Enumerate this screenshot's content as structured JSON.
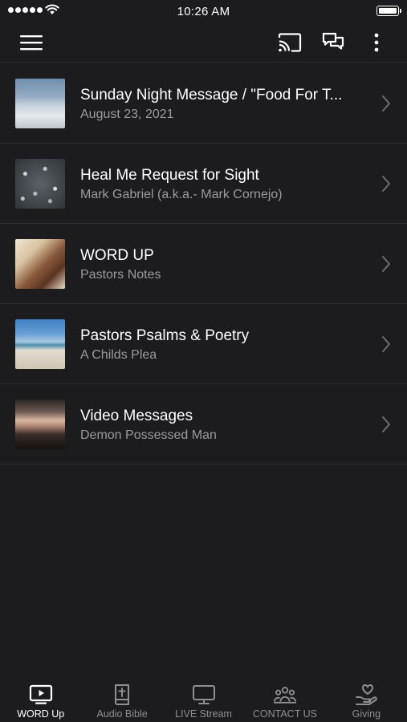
{
  "status_bar": {
    "time": "10:26 AM"
  },
  "top_bar": {
    "icons": [
      "menu-icon",
      "cast-icon",
      "chat-icon",
      "more-vertical-icon"
    ]
  },
  "list": {
    "items": [
      {
        "title": "Sunday Night Message / \"Food For T...",
        "subtitle": "August 23, 2021",
        "thumb": "clouds"
      },
      {
        "title": "Heal Me Request for Sight",
        "subtitle": "Mark Gabriel (a.k.a.- Mark Cornejo)",
        "thumb": "stars"
      },
      {
        "title": "WORD UP",
        "subtitle": "Pastors Notes",
        "thumb": "hands"
      },
      {
        "title": "Pastors Psalms & Poetry",
        "subtitle": "A Childs Plea",
        "thumb": "beach"
      },
      {
        "title": "Video Messages",
        "subtitle": "Demon Possessed Man",
        "thumb": "sunset"
      }
    ]
  },
  "tab_bar": {
    "tabs": [
      {
        "label": "WORD Up",
        "icon": "tv-play-icon",
        "active": true
      },
      {
        "label": "Audio Bible",
        "icon": "bible-icon",
        "active": false
      },
      {
        "label": "LIVE Stream",
        "icon": "monitor-icon",
        "active": false
      },
      {
        "label": "CONTACT US",
        "icon": "people-icon",
        "active": false
      },
      {
        "label": "Giving",
        "icon": "heart-hand-icon",
        "active": false
      }
    ]
  },
  "colors": {
    "background": "#1c1c1e",
    "divider": "#2e2e30",
    "subtitle": "#9a9a9f",
    "tab_inactive": "#8e8e93",
    "tab_active": "#ffffff"
  }
}
